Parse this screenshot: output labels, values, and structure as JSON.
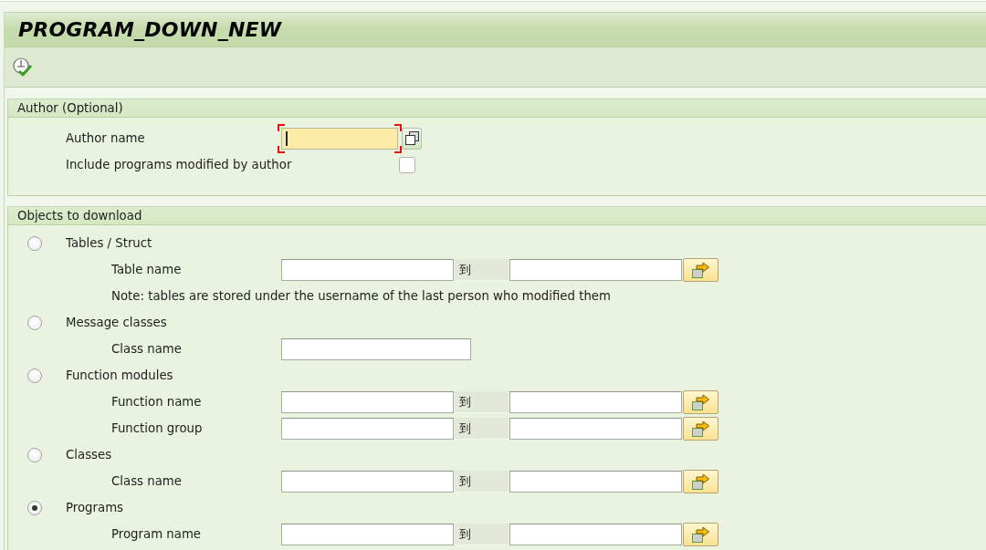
{
  "window": {
    "title": "PROGRAM_DOWN_NEW"
  },
  "groups": [
    {
      "title": "Author (Optional)",
      "fields": [
        {
          "kind": "input",
          "label": "Author name",
          "focused": true,
          "value_help": true
        },
        {
          "kind": "checkbox",
          "label": "Include programs modified by author",
          "checked": false
        }
      ]
    },
    {
      "title": "Objects to download",
      "fields": [
        {
          "kind": "radio",
          "label": "Tables / Struct",
          "selected": false,
          "children": [
            {
              "kind": "range",
              "label": "Table name",
              "separator": "到"
            },
            {
              "kind": "note",
              "text": "Note: tables are stored under the username of the last person who modified them"
            }
          ]
        },
        {
          "kind": "radio",
          "label": "Message classes",
          "selected": false,
          "children": [
            {
              "kind": "input",
              "label": "Class name",
              "focused": false,
              "value_help": false
            }
          ]
        },
        {
          "kind": "radio",
          "label": "Function modules",
          "selected": false,
          "children": [
            {
              "kind": "range",
              "label": "Function name",
              "separator": "到"
            },
            {
              "kind": "range",
              "label": "Function group",
              "separator": "到"
            }
          ]
        },
        {
          "kind": "radio",
          "label": "Classes",
          "selected": false,
          "children": [
            {
              "kind": "range",
              "label": "Class name",
              "separator": "到"
            }
          ]
        },
        {
          "kind": "radio",
          "label": "Programs",
          "selected": true,
          "children": [
            {
              "kind": "range",
              "label": "Program name",
              "separator": "到"
            }
          ]
        }
      ]
    }
  ]
}
